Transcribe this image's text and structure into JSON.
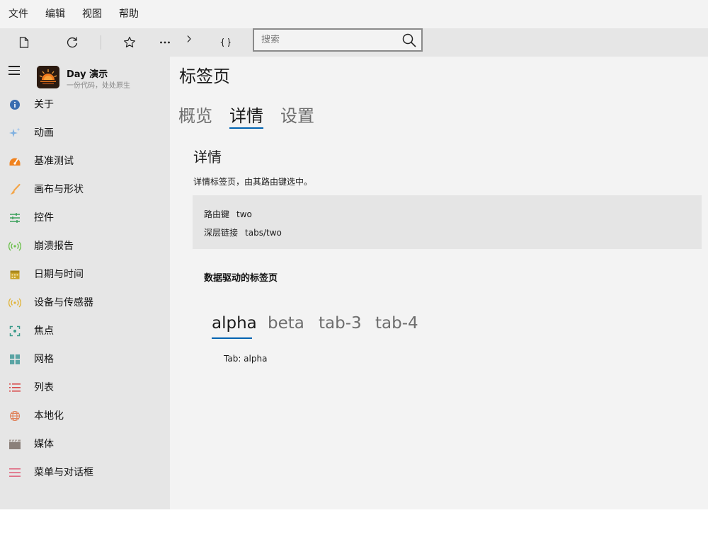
{
  "menubar": {
    "items": [
      "文件",
      "编辑",
      "视图",
      "帮助"
    ]
  },
  "toolbar": {
    "buttons": [
      "new-file-icon",
      "refresh-icon",
      "star-icon",
      "more-icon",
      "chevron-right-icon",
      "braces-icon"
    ],
    "search": {
      "placeholder": "搜索",
      "value": ""
    }
  },
  "sidebar": {
    "app_title": "Day 演示",
    "app_subtitle": "一份代码，处处原生",
    "items": [
      {
        "label": "关于",
        "icon": "info-icon",
        "color": "#3a6db0"
      },
      {
        "label": "动画",
        "icon": "sparkle-icon",
        "color": "#7fb0e0"
      },
      {
        "label": "基准测试",
        "icon": "gauge-icon",
        "color": "#f0821e"
      },
      {
        "label": "画布与形状",
        "icon": "brush-icon",
        "color": "#f3a64b"
      },
      {
        "label": "控件",
        "icon": "sliders-icon",
        "color": "#3aa05a"
      },
      {
        "label": "崩溃报告",
        "icon": "broadcast-icon",
        "color": "#6bc04b"
      },
      {
        "label": "日期与时间",
        "icon": "calendar-icon",
        "color": "#c9a227"
      },
      {
        "label": "设备与传感器",
        "icon": "sensor-icon",
        "color": "#e0b43a"
      },
      {
        "label": "焦点",
        "icon": "focus-icon",
        "color": "#3a9a8a"
      },
      {
        "label": "网格",
        "icon": "grid-icon",
        "color": "#5aa4a4"
      },
      {
        "label": "列表",
        "icon": "list-icon",
        "color": "#d84a4a"
      },
      {
        "label": "本地化",
        "icon": "globe-icon",
        "color": "#e0825a"
      },
      {
        "label": "媒体",
        "icon": "clapper-icon",
        "color": "#8a807a"
      },
      {
        "label": "菜单与对话框",
        "icon": "menu-icon",
        "color": "#e0607a"
      }
    ]
  },
  "main": {
    "title": "标签页",
    "tabs": [
      "概览",
      "详情",
      "设置"
    ],
    "active_tab": 1,
    "section": {
      "title": "详情",
      "description": "详情标签页，由其路由键选中。",
      "rows": [
        {
          "key": "路由键",
          "value": "two"
        },
        {
          "key": "深层链接",
          "value": "tabs/two"
        }
      ]
    },
    "data_tabs": {
      "title": "数据驱动的标签页",
      "tabs": [
        "alpha",
        "beta",
        "tab-3",
        "tab-4"
      ],
      "active": 0,
      "content": "Tab: alpha"
    }
  },
  "colors": {
    "accent": "#0063b1",
    "sidebar_bg": "#e6e6e6",
    "content_bg": "#f3f3f3"
  }
}
